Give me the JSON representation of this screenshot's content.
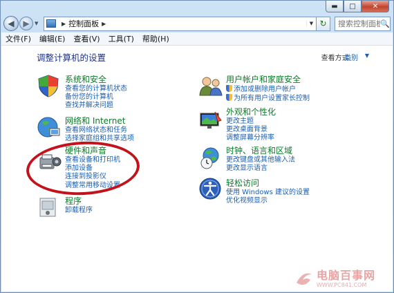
{
  "window": {
    "caption_buttons": {
      "minimize": "▬",
      "maximize": "□",
      "close": "✕"
    }
  },
  "nav": {
    "back_glyph": "◀",
    "forward_glyph": "▶",
    "history_glyph": "▼",
    "address_icon": "control-panel-icon",
    "breadcrumb": "控制面板",
    "address_dropdown_glyph": "▼",
    "refresh_glyph": "↻",
    "search_placeholder": "搜索控制面板",
    "search_icon": "🔍"
  },
  "menubar": [
    "文件(F)",
    "编辑(E)",
    "查看(V)",
    "工具(T)",
    "帮助(H)"
  ],
  "content": {
    "heading": "调整计算机的设置",
    "view_by_label": "查看方式:",
    "view_by_value": "类别",
    "view_by_drop": "▼"
  },
  "left_groups": [
    {
      "title": "系统和安全",
      "icon": "system-security-icon",
      "links": [
        "查看您的计算机状态",
        "备份您的计算机",
        "查找并解决问题"
      ]
    },
    {
      "title": "网络和 Internet",
      "icon": "network-internet-icon",
      "links": [
        "查看网络状态和任务",
        "选择家庭组和共享选项"
      ]
    },
    {
      "title": "硬件和声音",
      "icon": "hardware-sound-icon",
      "links": [
        "查看设备和打印机",
        "添加设备",
        "连接到投影仪",
        "调整常用移动设置"
      ]
    },
    {
      "title": "程序",
      "icon": "programs-icon",
      "links": [
        "卸载程序"
      ]
    }
  ],
  "right_groups": [
    {
      "title": "用户帐户和家庭安全",
      "icon": "user-accounts-icon",
      "links": [
        "添加或删除用户帐户",
        "为所有用户设置家长控制"
      ]
    },
    {
      "title": "外观和个性化",
      "icon": "appearance-icon",
      "links": [
        "更改主题",
        "更改桌面背景",
        "调整屏幕分辨率"
      ]
    },
    {
      "title": "时钟、语言和区域",
      "icon": "clock-language-icon",
      "links": [
        "更改键盘或其他输入法",
        "更改显示语言"
      ]
    },
    {
      "title": "轻松访问",
      "icon": "ease-of-access-icon",
      "links": [
        "使用 Windows 建议的设置",
        "优化视频显示"
      ]
    }
  ],
  "watermark": {
    "name": "电脑百事网",
    "url": "WWW.PC841.COM"
  },
  "colors": {
    "group_title": "#0b7a28",
    "link": "#1a5fb4",
    "heading": "#1e3287",
    "annotation": "#c2121c"
  }
}
